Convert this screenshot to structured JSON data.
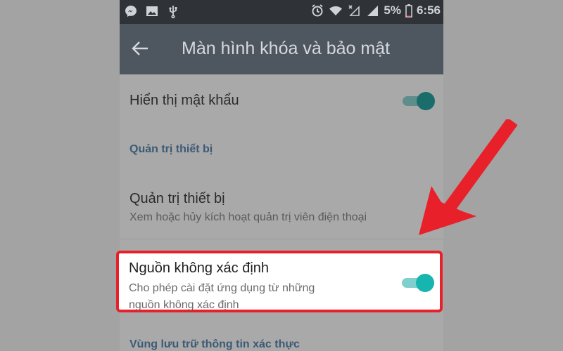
{
  "status_bar": {
    "battery": "5%",
    "time": "6:56",
    "icons": [
      "messenger-icon",
      "gallery-icon",
      "usb-icon",
      "alarm-icon",
      "wifi-icon",
      "no-signal-icon",
      "signal-icon",
      "battery-icon"
    ]
  },
  "app_bar": {
    "title": "Màn hình khóa và bảo mật",
    "back_icon": "back-arrow-icon"
  },
  "settings": {
    "show_password": {
      "title": "Hiển thị mật khẩu",
      "enabled": true
    },
    "device_admin_section": "Quản trị thiết bị",
    "device_admin": {
      "title": "Quản trị thiết bị",
      "subtitle": "Xem hoặc hủy kích hoạt quản trị viên điện thoại"
    },
    "unknown_sources": {
      "title": "Nguồn không xác định",
      "subtitle_line1": "Cho phép cài đặt ứng dụng từ những",
      "subtitle_line2": "nguồn không xác định",
      "enabled": true
    },
    "credential_storage_section": "Vùng lưu trữ thông tin xác thực"
  },
  "colors": {
    "highlight_border": "#e8202a",
    "toggle_accent": "#17b5b0",
    "app_bar": "#4e5660",
    "status_bar": "#2f3338"
  }
}
